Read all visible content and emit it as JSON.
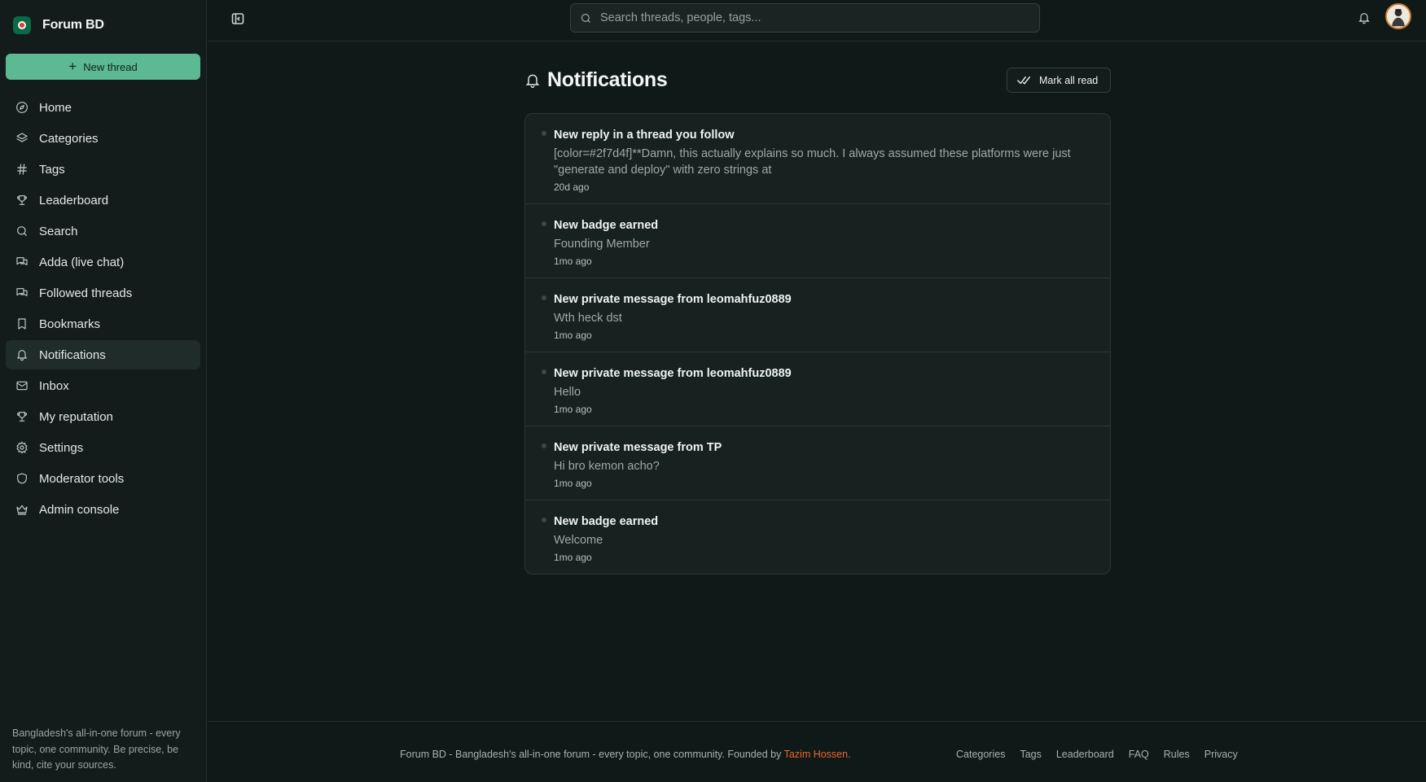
{
  "brand": {
    "name": "Forum BD"
  },
  "sidebar": {
    "new_thread_label": "New thread",
    "items": [
      {
        "label": "Home",
        "icon": "compass-icon"
      },
      {
        "label": "Categories",
        "icon": "layers-icon"
      },
      {
        "label": "Tags",
        "icon": "hash-icon"
      },
      {
        "label": "Leaderboard",
        "icon": "trophy-icon"
      },
      {
        "label": "Search",
        "icon": "search-icon"
      },
      {
        "label": "Adda (live chat)",
        "icon": "chat-icon"
      },
      {
        "label": "Followed threads",
        "icon": "chat-icon"
      },
      {
        "label": "Bookmarks",
        "icon": "bookmark-icon"
      },
      {
        "label": "Notifications",
        "icon": "bell-icon",
        "active": true
      },
      {
        "label": "Inbox",
        "icon": "mail-icon"
      },
      {
        "label": "My reputation",
        "icon": "trophy-icon"
      },
      {
        "label": "Settings",
        "icon": "gear-icon"
      },
      {
        "label": "Moderator tools",
        "icon": "shield-icon"
      },
      {
        "label": "Admin console",
        "icon": "crown-icon"
      }
    ],
    "tagline": "Bangladesh's all-in-one forum - every topic, one community. Be precise, be kind, cite your sources."
  },
  "topbar": {
    "search_placeholder": "Search threads, people, tags..."
  },
  "main": {
    "title": "Notifications",
    "mark_all_read_label": "Mark all read",
    "notifications": [
      {
        "title": "New reply in a thread you follow",
        "body": "[color=#2f7d4f]**Damn, this actually explains so much. I always assumed these platforms were just \"generate and deploy\" with zero strings at",
        "time": "20d ago"
      },
      {
        "title": "New badge earned",
        "body": "Founding Member",
        "time": "1mo ago"
      },
      {
        "title": "New private message from leomahfuz0889",
        "body": "Wth heck dst",
        "time": "1mo ago"
      },
      {
        "title": "New private message from leomahfuz0889",
        "body": "Hello",
        "time": "1mo ago"
      },
      {
        "title": "New private message from TP",
        "body": "Hi bro kemon acho?",
        "time": "1mo ago"
      },
      {
        "title": "New badge earned",
        "body": "Welcome",
        "time": "1mo ago"
      }
    ]
  },
  "footer": {
    "text": "Forum BD - Bangladesh's all-in-one forum - every topic, one community. Founded by",
    "author": "Tazim Hossen.",
    "links": [
      "Categories",
      "Tags",
      "Leaderboard",
      "FAQ",
      "Rules",
      "Privacy"
    ]
  },
  "colors": {
    "accent": "#5cb993",
    "author_link": "#f0642a",
    "background": "#0f1917"
  }
}
